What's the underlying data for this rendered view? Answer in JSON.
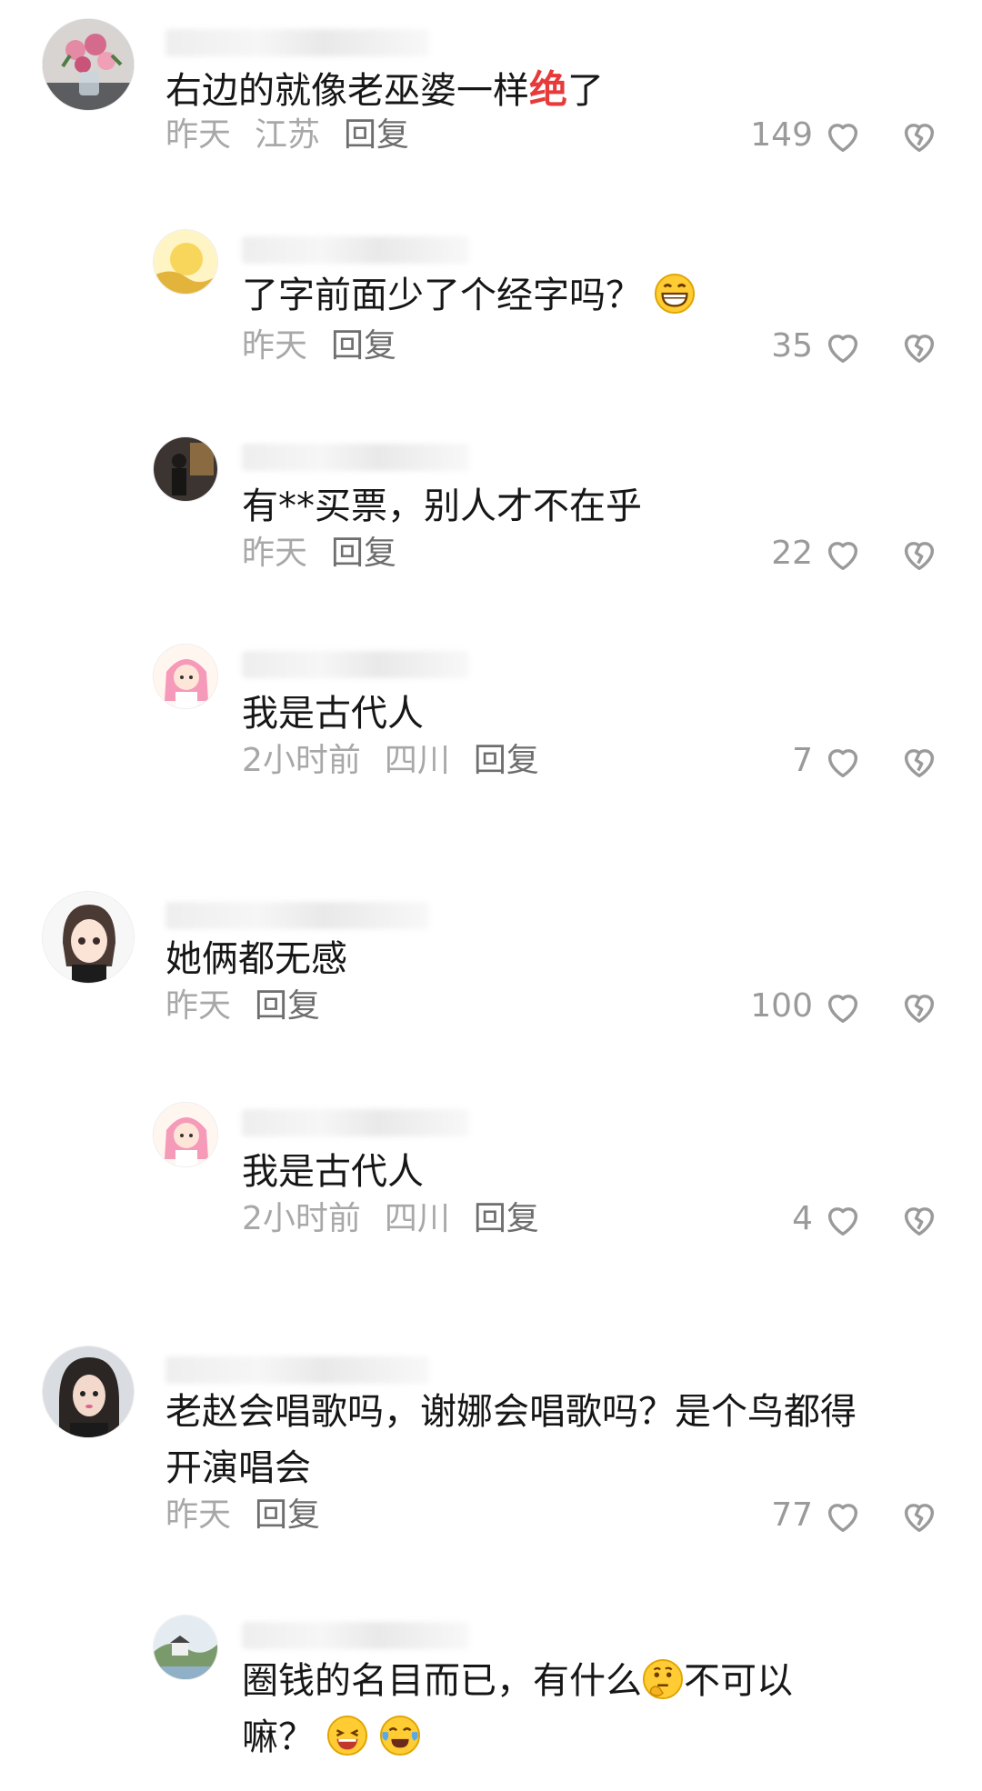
{
  "comments": [
    {
      "text_before": "右边的就像老巫婆一样",
      "highlight": "绝",
      "text_after": "了",
      "time": "昨天",
      "location": "江苏",
      "reply_label": "回复",
      "likes": "149"
    },
    {
      "text": "了字前面少了个经字吗？",
      "time": "昨天",
      "reply_label": "回复",
      "likes": "35"
    },
    {
      "text": "有**买票，别人才不在乎",
      "time": "昨天",
      "reply_label": "回复",
      "likes": "22"
    },
    {
      "text": "我是古代人",
      "time": "2小时前",
      "location": "四川",
      "reply_label": "回复",
      "likes": "7"
    },
    {
      "text": "她俩都无感",
      "time": "昨天",
      "reply_label": "回复",
      "likes": "100"
    },
    {
      "text": "我是古代人",
      "time": "2小时前",
      "location": "四川",
      "reply_label": "回复",
      "likes": "4"
    },
    {
      "text_line1": "老赵会唱歌吗，谢娜会唱歌吗？是个鸟都得",
      "text_line2": "开演唱会",
      "time": "昨天",
      "reply_label": "回复",
      "likes": "77"
    },
    {
      "text_before": "圈钱的名目而已，有什么",
      "text_after": "不可以",
      "text_line2": "嘛？"
    }
  ],
  "colors": {
    "text": "#161616",
    "meta": "#a8a8a8",
    "reply": "#6e6e6e",
    "accent": "#e73a3a"
  }
}
